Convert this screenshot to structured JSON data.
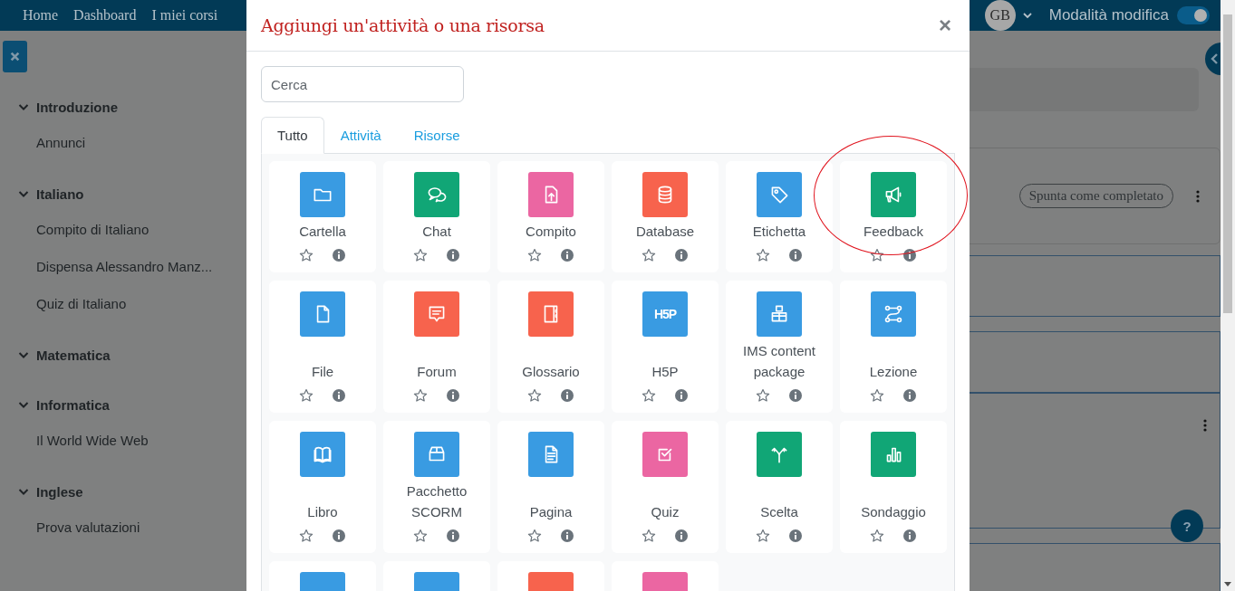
{
  "navbar": {
    "links": [
      "Home",
      "Dashboard",
      "I miei corsi"
    ],
    "avatar": "GB",
    "edit_mode": {
      "label": "Modalità modifica",
      "on": true
    }
  },
  "sidebar": {
    "sections": [
      {
        "title": "Introduzione",
        "expanded": true,
        "children": [
          {
            "label": "Annunci"
          }
        ]
      },
      {
        "title": "Italiano",
        "expanded": true,
        "children": [
          {
            "label": "Compito di Italiano"
          },
          {
            "label": "Dispensa Alessandro Manz..."
          },
          {
            "label": "Quiz di Italiano"
          }
        ]
      },
      {
        "title": "Matematica",
        "expanded": true
      },
      {
        "title": "Informatica",
        "expanded": true,
        "children": [
          {
            "label": "Il World Wide Web"
          }
        ]
      },
      {
        "title": "Inglese",
        "expanded": true,
        "children": [
          {
            "label": "Prova valutazioni"
          }
        ]
      }
    ]
  },
  "course": {
    "complete_button": "Spunta come completato"
  },
  "help_button": "?",
  "modal": {
    "title": "Aggiungi un'attività o una risorsa",
    "close": "×",
    "search": {
      "placeholder": "Cerca"
    },
    "tabs": [
      {
        "label": "Tutto",
        "selected": true
      },
      {
        "label": "Attività",
        "selected": false
      },
      {
        "label": "Risorse",
        "selected": false
      }
    ],
    "items": [
      {
        "label": "Cartella",
        "kind": "folder",
        "color": "#399be2",
        "circled": false
      },
      {
        "label": "Chat",
        "kind": "chat",
        "color": "#11a676",
        "circled": false
      },
      {
        "label": "Compito",
        "kind": "upload",
        "color": "#eb66a2",
        "circled": false
      },
      {
        "label": "Database",
        "kind": "database",
        "color": "#f7634d",
        "circled": false
      },
      {
        "label": "Etichetta",
        "kind": "tag",
        "color": "#399be2",
        "circled": false
      },
      {
        "label": "Feedback",
        "kind": "megaphone",
        "color": "#11a676",
        "circled": true
      },
      {
        "label": "File",
        "kind": "file",
        "color": "#399be2",
        "circled": false
      },
      {
        "label": "Forum",
        "kind": "forum",
        "color": "#f7634d",
        "circled": false
      },
      {
        "label": "Glossario",
        "kind": "notebook",
        "color": "#f7634d",
        "circled": false
      },
      {
        "label": "H5P",
        "kind": "logo",
        "icon_text": "H5P",
        "color": "#399be2",
        "circled": false
      },
      {
        "label": "IMS content package",
        "kind": "boxes",
        "color": "#399be2",
        "circled": false
      },
      {
        "label": "Lezione",
        "kind": "path",
        "color": "#399be2",
        "circled": false
      },
      {
        "label": "Libro",
        "kind": "book",
        "color": "#399be2",
        "circled": false
      },
      {
        "label": "Pacchetto SCORM",
        "kind": "box",
        "color": "#399be2",
        "circled": false
      },
      {
        "label": "Pagina",
        "kind": "page",
        "color": "#399be2",
        "circled": false
      },
      {
        "label": "Quiz",
        "kind": "checkbox",
        "color": "#eb66a2",
        "circled": false
      },
      {
        "label": "Scelta",
        "kind": "fork",
        "color": "#11a676",
        "circled": false
      },
      {
        "label": "Sondaggio",
        "kind": "bars",
        "color": "#11a676",
        "circled": false
      },
      {
        "kind": "blank",
        "color": "#399be2",
        "circled": false
      },
      {
        "kind": "blank",
        "color": "#399be2",
        "circled": false
      },
      {
        "kind": "blank",
        "color": "#f7634d",
        "circled": false
      },
      {
        "kind": "blank",
        "color": "#eb66a2",
        "circled": false
      }
    ]
  }
}
